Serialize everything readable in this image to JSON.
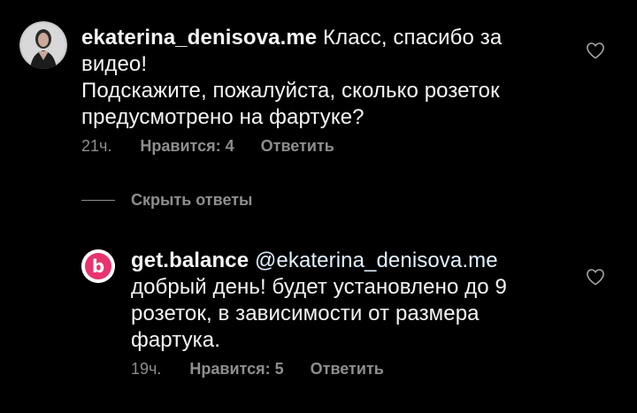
{
  "comments": [
    {
      "username": "ekaterina_denisova.me",
      "text_line1": "Класс, спасибо за",
      "text_line2": "видео!",
      "text_line3": "Подскажите, пожалуйста, сколько розеток",
      "text_line4": "предусмотрено на фартуке?",
      "time": "21ч.",
      "likes": "Нравится: 4",
      "reply": "Ответить",
      "avatar_icon": "profile-photo",
      "like_icon": "heart-outline-icon"
    }
  ],
  "thread": {
    "hide_replies": "Скрыть ответы"
  },
  "replies": [
    {
      "username": "get.balance",
      "mention": "@ekaterina_denisova.me",
      "text_line1": "добрый день! будет установлено до 9",
      "text_line2": "розеток, в зависимости от размера",
      "text_line3": "фартука.",
      "time": "19ч.",
      "likes": "Нравится: 5",
      "reply": "Ответить",
      "avatar_letter": "b",
      "avatar_color": "#e8336e",
      "like_icon": "heart-outline-icon"
    }
  ],
  "colors": {
    "background": "#000000",
    "primary_text": "#f5f5f5",
    "secondary_text": "#8e8e8e"
  }
}
